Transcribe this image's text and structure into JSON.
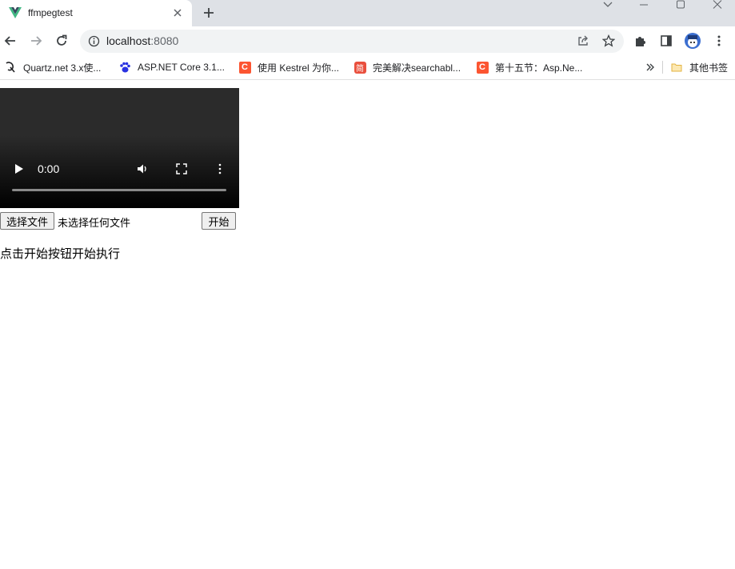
{
  "tab": {
    "title": "ffmpegtest"
  },
  "address": {
    "host": "localhost",
    "port": ":8080"
  },
  "bookmarks": [
    {
      "label": "Quartz.net 3.x使...",
      "icon": "quartz-icon"
    },
    {
      "label": "ASP.NET Core 3.1...",
      "icon": "paw-icon"
    },
    {
      "label": "使用 Kestrel 为你...",
      "icon": "csdn-icon",
      "glyph": "C"
    },
    {
      "label": "完美解决searchabl...",
      "icon": "jian-icon",
      "glyph": "简"
    },
    {
      "label": "第十五节：Asp.Ne...",
      "icon": "csdn-icon",
      "glyph": "C"
    }
  ],
  "other_bookmarks": "其他书签",
  "video": {
    "time": "0:00"
  },
  "file_input": {
    "button_label": "选择文件",
    "status": "未选择任何文件"
  },
  "start_button": "开始",
  "message": "点击开始按钮开始执行",
  "colors": {
    "tabstrip": "#dee1e6",
    "csdn": "#fc5531",
    "jian": "#e94f3d"
  }
}
